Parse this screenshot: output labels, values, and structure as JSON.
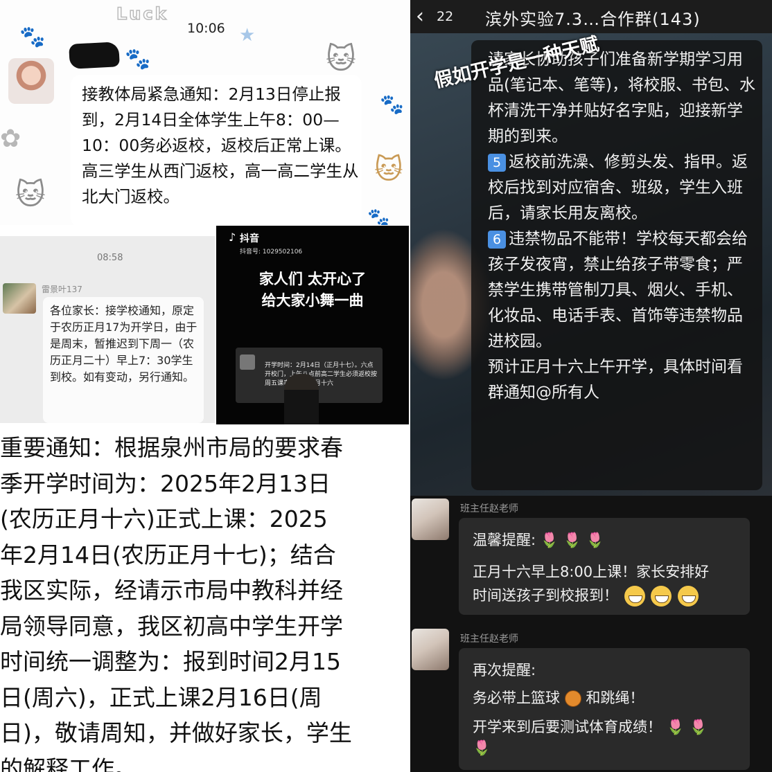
{
  "panel_a": {
    "luck_text": "Luck",
    "time": "10:06",
    "message": "接教体局紧急通知：2月13日停止报到，2月14日全体学生上午8：00—10：00务必返校，返校后正常上课。高三学生从西门返校，高一高二学生从北大门返校。"
  },
  "panel_b": {
    "time": "08:58",
    "sender": "雷景叶137",
    "message": "各位家长：接学校通知，原定于农历正月17为开学日，由于是周末，暂推迟到下周一（农历正月二十）早上7：30学生到校。如有变动，另行通知。"
  },
  "panel_c": {
    "app_name": "抖音",
    "handle": "抖音号: 1029502106",
    "caption_line1": "家人们 太开心了",
    "caption_line2": "给大家小舞一曲",
    "card_text": "开学时间：2月14日（正月十七）。六点开校门，上午八点前高二学生必须返校按周五课表上课。正月十六"
  },
  "panel_d": {
    "message": "重要通知：根据泉州市局的要求春\n季开学时间为：2025年2月13日\n(农历正月十六)正式上课：2025\n年2月14日(农历正月十七)；结合\n我区实际，经请示市局中教科并经\n局领导同意，我区初高中学生开学\n时间统一调整为：报到时间2月15\n日(周六)，正式上课2月16日(周\n日)，敬请周知，并做好家长，学生\n的解释工作。"
  },
  "panel_e": {
    "unread_count": "22",
    "group_title": "滨外实验7.3…合作群(143)",
    "overlay_text": "假如开学是一种天赋",
    "intro": "请家长协助孩子们准备新学期学习用品(笔记本、笔等)，将校服、书包、水杯清洗干净并贴好名字贴，迎接新学期的到来。",
    "item5_num": "5",
    "item5_text": "返校前洗澡、修剪头发、指甲。返校后找到对应宿舍、班级，学生入班后，请家长用友离校。",
    "item6_num": "6",
    "item6_text": "违禁物品不能带！学校每天都会给孩子发夜宵，禁止给孩子带零食；严禁学生携带管制刀具、烟火、手机、化妆品、电话手表、首饰等违禁物品进校园。",
    "outro": "预计正月十六上午开学，具体时间看群通知@所有人"
  },
  "panel_f": {
    "sender_name": "班主任赵老师",
    "msg1_title": "温馨提醒:",
    "msg1_line1": "正月十六早上8:00上课！家长安排好",
    "msg1_line2": "时间送孩子到校报到！",
    "msg2_title": "再次提醒:",
    "msg2_line1a": "务必带上篮球",
    "msg2_line1b": "和跳绳！",
    "msg2_line2": "开学来到后要测试体育成绩！"
  }
}
